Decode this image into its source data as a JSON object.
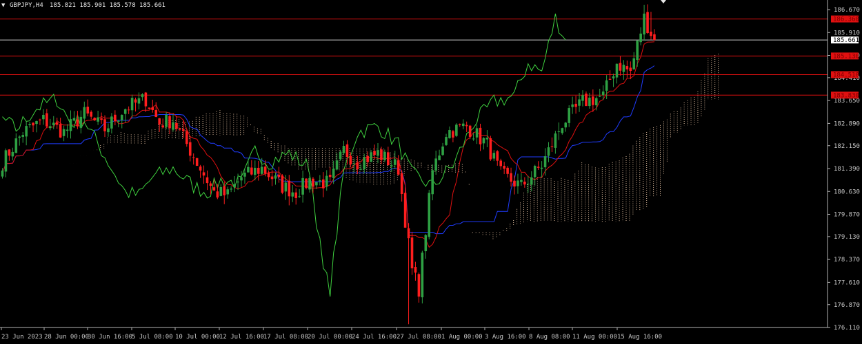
{
  "header": {
    "symbol": "GBPJPY,H4",
    "ohlc": "185.821 185.901 185.578 185.661"
  },
  "chart_data": {
    "type": "candlestick",
    "ylim": [
      176.11,
      186.67
    ],
    "y_ticks": [
      "186.670",
      "185.910",
      "185.150",
      "184.410",
      "183.650",
      "182.890",
      "182.150",
      "181.390",
      "180.630",
      "179.870",
      "179.130",
      "178.370",
      "177.610",
      "176.870",
      "176.110"
    ],
    "x_ticks": [
      "23 Jun 2023",
      "28 Jun 00:00",
      "30 Jun 16:00",
      "5 Jul 08:00",
      "10 Jul 00:00",
      "12 Jul 16:00",
      "17 Jul 08:00",
      "20 Jul 00:00",
      "24 Jul 16:00",
      "27 Jul 08:00",
      "1 Aug 00:00",
      "3 Aug 16:00",
      "8 Aug 08:00",
      "11 Aug 00:00",
      "15 Aug 16:00"
    ],
    "current_price": {
      "label": "185.661",
      "value": 185.661
    },
    "levels": [
      {
        "label": "186.360",
        "value": 186.36
      },
      {
        "label": "185.130",
        "value": 185.13
      },
      {
        "label": "184.510",
        "value": 184.51
      },
      {
        "label": "183.830",
        "value": 183.83
      }
    ],
    "anchors": [
      [
        0,
        181.6
      ],
      [
        6,
        182.6
      ],
      [
        12,
        183.0
      ],
      [
        18,
        182.6
      ],
      [
        24,
        183.2
      ],
      [
        30,
        182.7
      ],
      [
        36,
        183.4
      ],
      [
        42,
        183.7
      ],
      [
        46,
        182.9
      ],
      [
        50,
        183.0
      ],
      [
        56,
        181.8
      ],
      [
        62,
        180.6
      ],
      [
        66,
        180.5
      ],
      [
        70,
        181.1
      ],
      [
        76,
        181.4
      ],
      [
        82,
        180.8
      ],
      [
        86,
        180.6
      ],
      [
        90,
        181.0
      ],
      [
        96,
        180.9
      ],
      [
        100,
        182.0
      ],
      [
        104,
        181.6
      ],
      [
        110,
        181.9
      ],
      [
        116,
        181.4
      ],
      [
        120,
        178.0
      ],
      [
        122,
        177.4
      ],
      [
        126,
        181.3
      ],
      [
        130,
        182.6
      ],
      [
        136,
        182.8
      ],
      [
        142,
        182.2
      ],
      [
        146,
        181.2
      ],
      [
        152,
        180.8
      ],
      [
        158,
        181.5
      ],
      [
        164,
        182.9
      ],
      [
        170,
        183.6
      ],
      [
        176,
        183.8
      ],
      [
        180,
        184.9
      ],
      [
        184,
        184.6
      ],
      [
        188,
        186.4
      ],
      [
        191,
        185.66
      ]
    ],
    "colors": {
      "up": "#2ea043",
      "down": "#ff1e1e",
      "kijun": "#1f3cff",
      "tenkan": "#e01010",
      "chikou": "#3fd13f",
      "cloud": "#d9b89a",
      "level": "#e01010",
      "price_line": "#c8c8c8",
      "axis": "#b4b4b4"
    }
  }
}
